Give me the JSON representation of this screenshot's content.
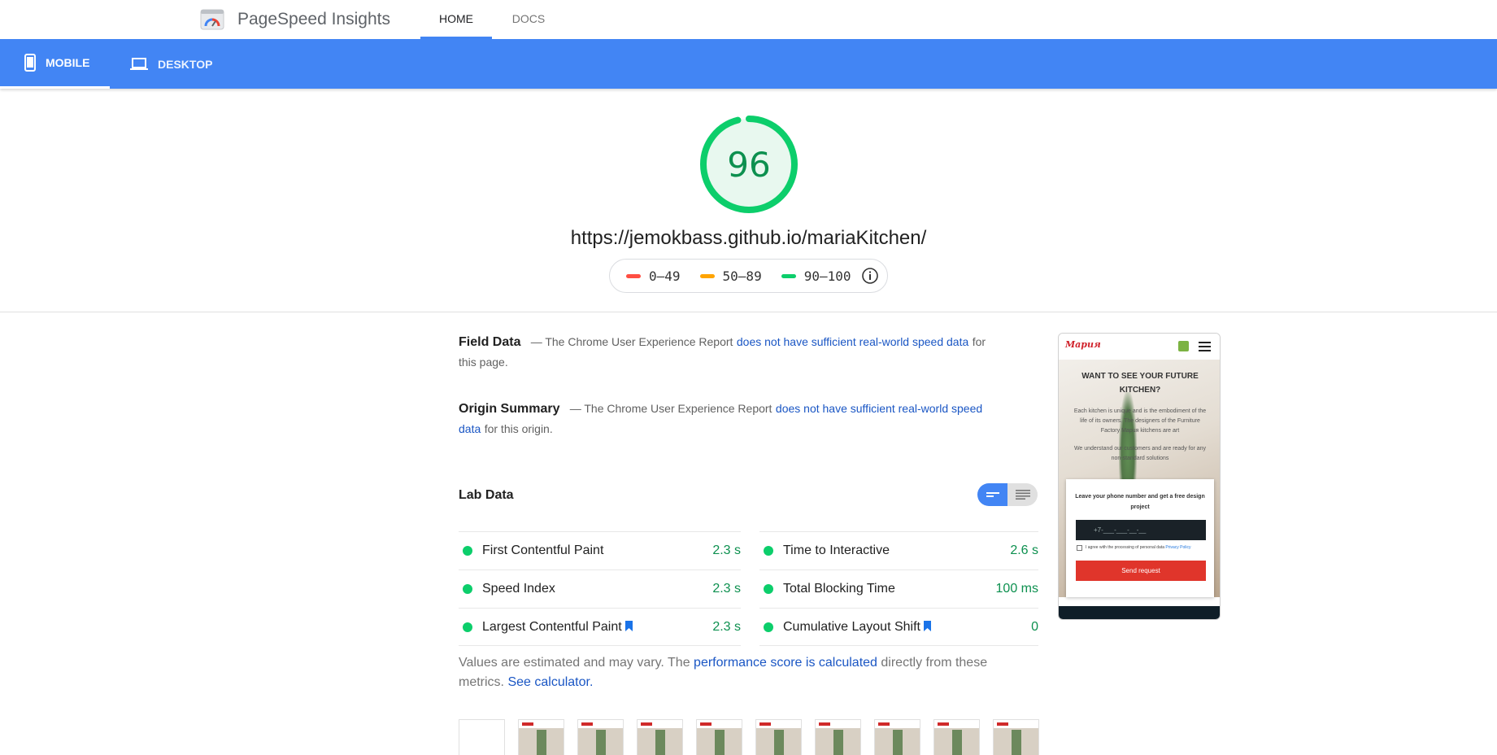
{
  "header": {
    "app_title": "PageSpeed Insights",
    "tabs": [
      {
        "label": "HOME",
        "active": true
      },
      {
        "label": "DOCS",
        "active": false
      }
    ]
  },
  "device_tabs": [
    {
      "label": "MOBILE",
      "icon": "smartphone-icon",
      "active": true
    },
    {
      "label": "DESKTOP",
      "icon": "laptop-icon",
      "active": false
    }
  ],
  "score": {
    "value": "96",
    "fraction": 0.96,
    "color": "#0cce6b",
    "text_color": "#0d904f",
    "fill_color": "#e8f8ef"
  },
  "url": "https://jemokbass.github.io/mariaKitchen/",
  "legend": [
    {
      "range": "0–49",
      "color": "#ff4e42"
    },
    {
      "range": "50–89",
      "color": "#ffa400"
    },
    {
      "range": "90–100",
      "color": "#0cce6b"
    }
  ],
  "field_data": {
    "title": "Field Data",
    "prefix": "— The Chrome User Experience Report",
    "link": "does not have sufficient real-world speed data",
    "suffix": "for this page."
  },
  "origin_summary": {
    "title": "Origin Summary",
    "prefix": "— The Chrome User Experience Report",
    "link": "does not have sufficient real-world speed data",
    "suffix": "for this origin."
  },
  "lab_data": {
    "title": "Lab Data",
    "left_metrics": [
      {
        "label": "First Contentful Paint",
        "value": "2.3 s",
        "bookmark": false
      },
      {
        "label": "Speed Index",
        "value": "2.3 s",
        "bookmark": false
      },
      {
        "label": "Largest Contentful Paint",
        "value": "2.3 s",
        "bookmark": true
      }
    ],
    "right_metrics": [
      {
        "label": "Time to Interactive",
        "value": "2.6 s",
        "bookmark": false
      },
      {
        "label": "Total Blocking Time",
        "value": "100 ms",
        "bookmark": false
      },
      {
        "label": "Cumulative Layout Shift",
        "value": "0",
        "bookmark": true
      }
    ]
  },
  "estimate": {
    "prefix": "Values are estimated and may vary. The",
    "link1": "performance score is calculated",
    "middle": "directly from these metrics.",
    "link2": "See calculator."
  },
  "preview": {
    "logo": "Марuя",
    "heading": "WANT TO SEE YOUR FUTURE KITCHEN?",
    "para1": "Each kitchen is unique and is the embodiment of the life of its owners. The designers of the Furniture Factory Mapuя kitchens are art",
    "para2": "We understand our customers and are ready for any non-standard solutions",
    "card_title": "Leave your phone number and get a free design project",
    "input_placeholder": "+7-___-___-__-__",
    "agree": "I agree with the processing of personal data",
    "agree_link": "Privacy Policy",
    "button": "Send request"
  },
  "filmstrip_frames": 10
}
